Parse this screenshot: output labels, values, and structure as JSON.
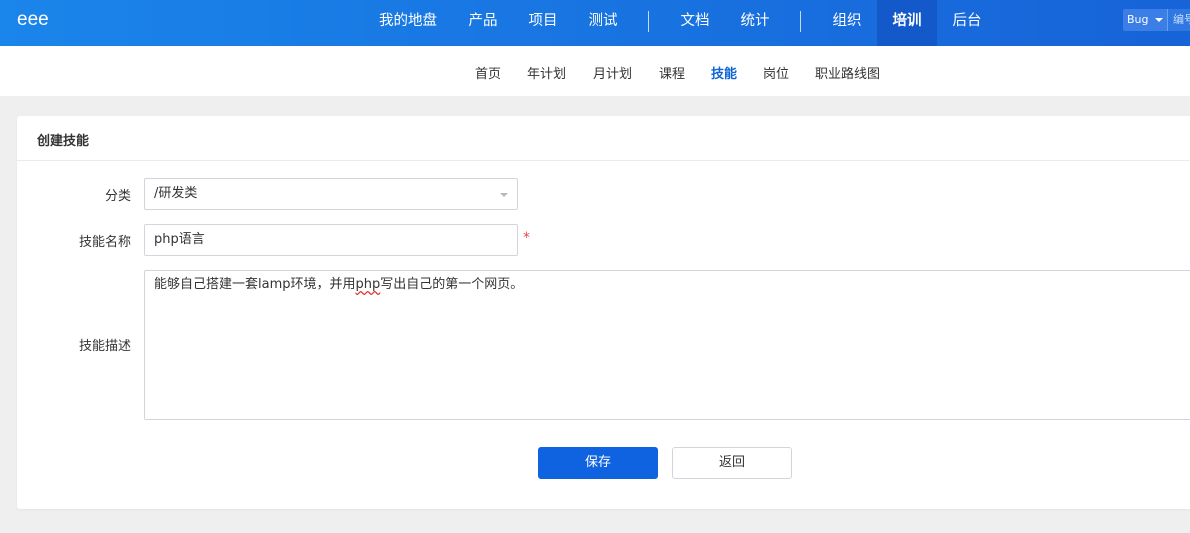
{
  "header": {
    "logo": "eee",
    "nav": [
      {
        "label": "我的地盘",
        "active": false
      },
      {
        "label": "产品",
        "active": false
      },
      {
        "label": "项目",
        "active": false
      },
      {
        "label": "测试",
        "active": false
      },
      {
        "label": "文档",
        "active": false
      },
      {
        "label": "统计",
        "active": false
      },
      {
        "label": "组织",
        "active": false
      },
      {
        "label": "培训",
        "active": true
      },
      {
        "label": "后台",
        "active": false
      }
    ],
    "search": {
      "type": "Bug",
      "placeholder": "编号"
    }
  },
  "subnav": [
    {
      "label": "首页",
      "active": false
    },
    {
      "label": "年计划",
      "active": false
    },
    {
      "label": "月计划",
      "active": false
    },
    {
      "label": "课程",
      "active": false
    },
    {
      "label": "技能",
      "active": true
    },
    {
      "label": "岗位",
      "active": false
    },
    {
      "label": "职业路线图",
      "active": false
    }
  ],
  "form": {
    "title": "创建技能",
    "category_label": "分类",
    "category_value": "/研发类",
    "name_label": "技能名称",
    "name_value": "php语言",
    "required_mark": "*",
    "desc_label": "技能描述",
    "desc_before": "能够自己搭建一套lamp环境，并用",
    "desc_flagged": "php",
    "desc_after": "写出自己的第一个网页。",
    "save_label": "保存",
    "back_label": "返回"
  },
  "colors": {
    "header_start": "#1a85ea",
    "header_end": "#1763d8",
    "primary": "#0f62e0",
    "active_subnav": "#0c64d6",
    "required": "#e84a4a"
  }
}
